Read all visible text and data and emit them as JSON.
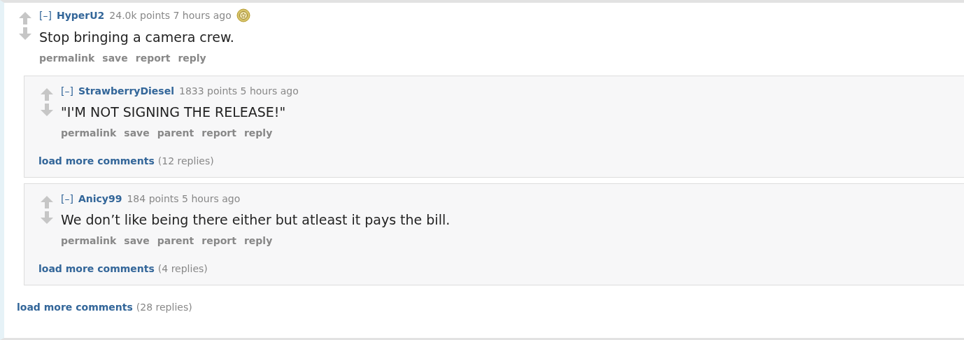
{
  "comment": {
    "toggle": "[–]",
    "author": "HyperU2",
    "score": "24.0k points",
    "time": "7 hours ago",
    "gilded": true,
    "body": "Stop bringing a camera crew.",
    "actions": [
      "permalink",
      "save",
      "report",
      "reply"
    ],
    "children": [
      {
        "toggle": "[–]",
        "author": "StrawberryDiesel",
        "score": "1833 points",
        "time": "5 hours ago",
        "gilded": false,
        "body": "\"I'M NOT SIGNING THE RELEASE!\"",
        "actions": [
          "permalink",
          "save",
          "parent",
          "report",
          "reply"
        ],
        "load_more": {
          "link": "load more comments",
          "count": "(12 replies)"
        }
      },
      {
        "toggle": "[–]",
        "author": "Anicy99",
        "score": "184 points",
        "time": "5 hours ago",
        "gilded": false,
        "body": "We don’t like being there either but atleast it pays the bill.",
        "actions": [
          "permalink",
          "save",
          "parent",
          "report",
          "reply"
        ],
        "load_more": {
          "link": "load more comments",
          "count": "(4 replies)"
        }
      }
    ],
    "load_more": {
      "link": "load more comments",
      "count": "(28 replies)"
    }
  }
}
